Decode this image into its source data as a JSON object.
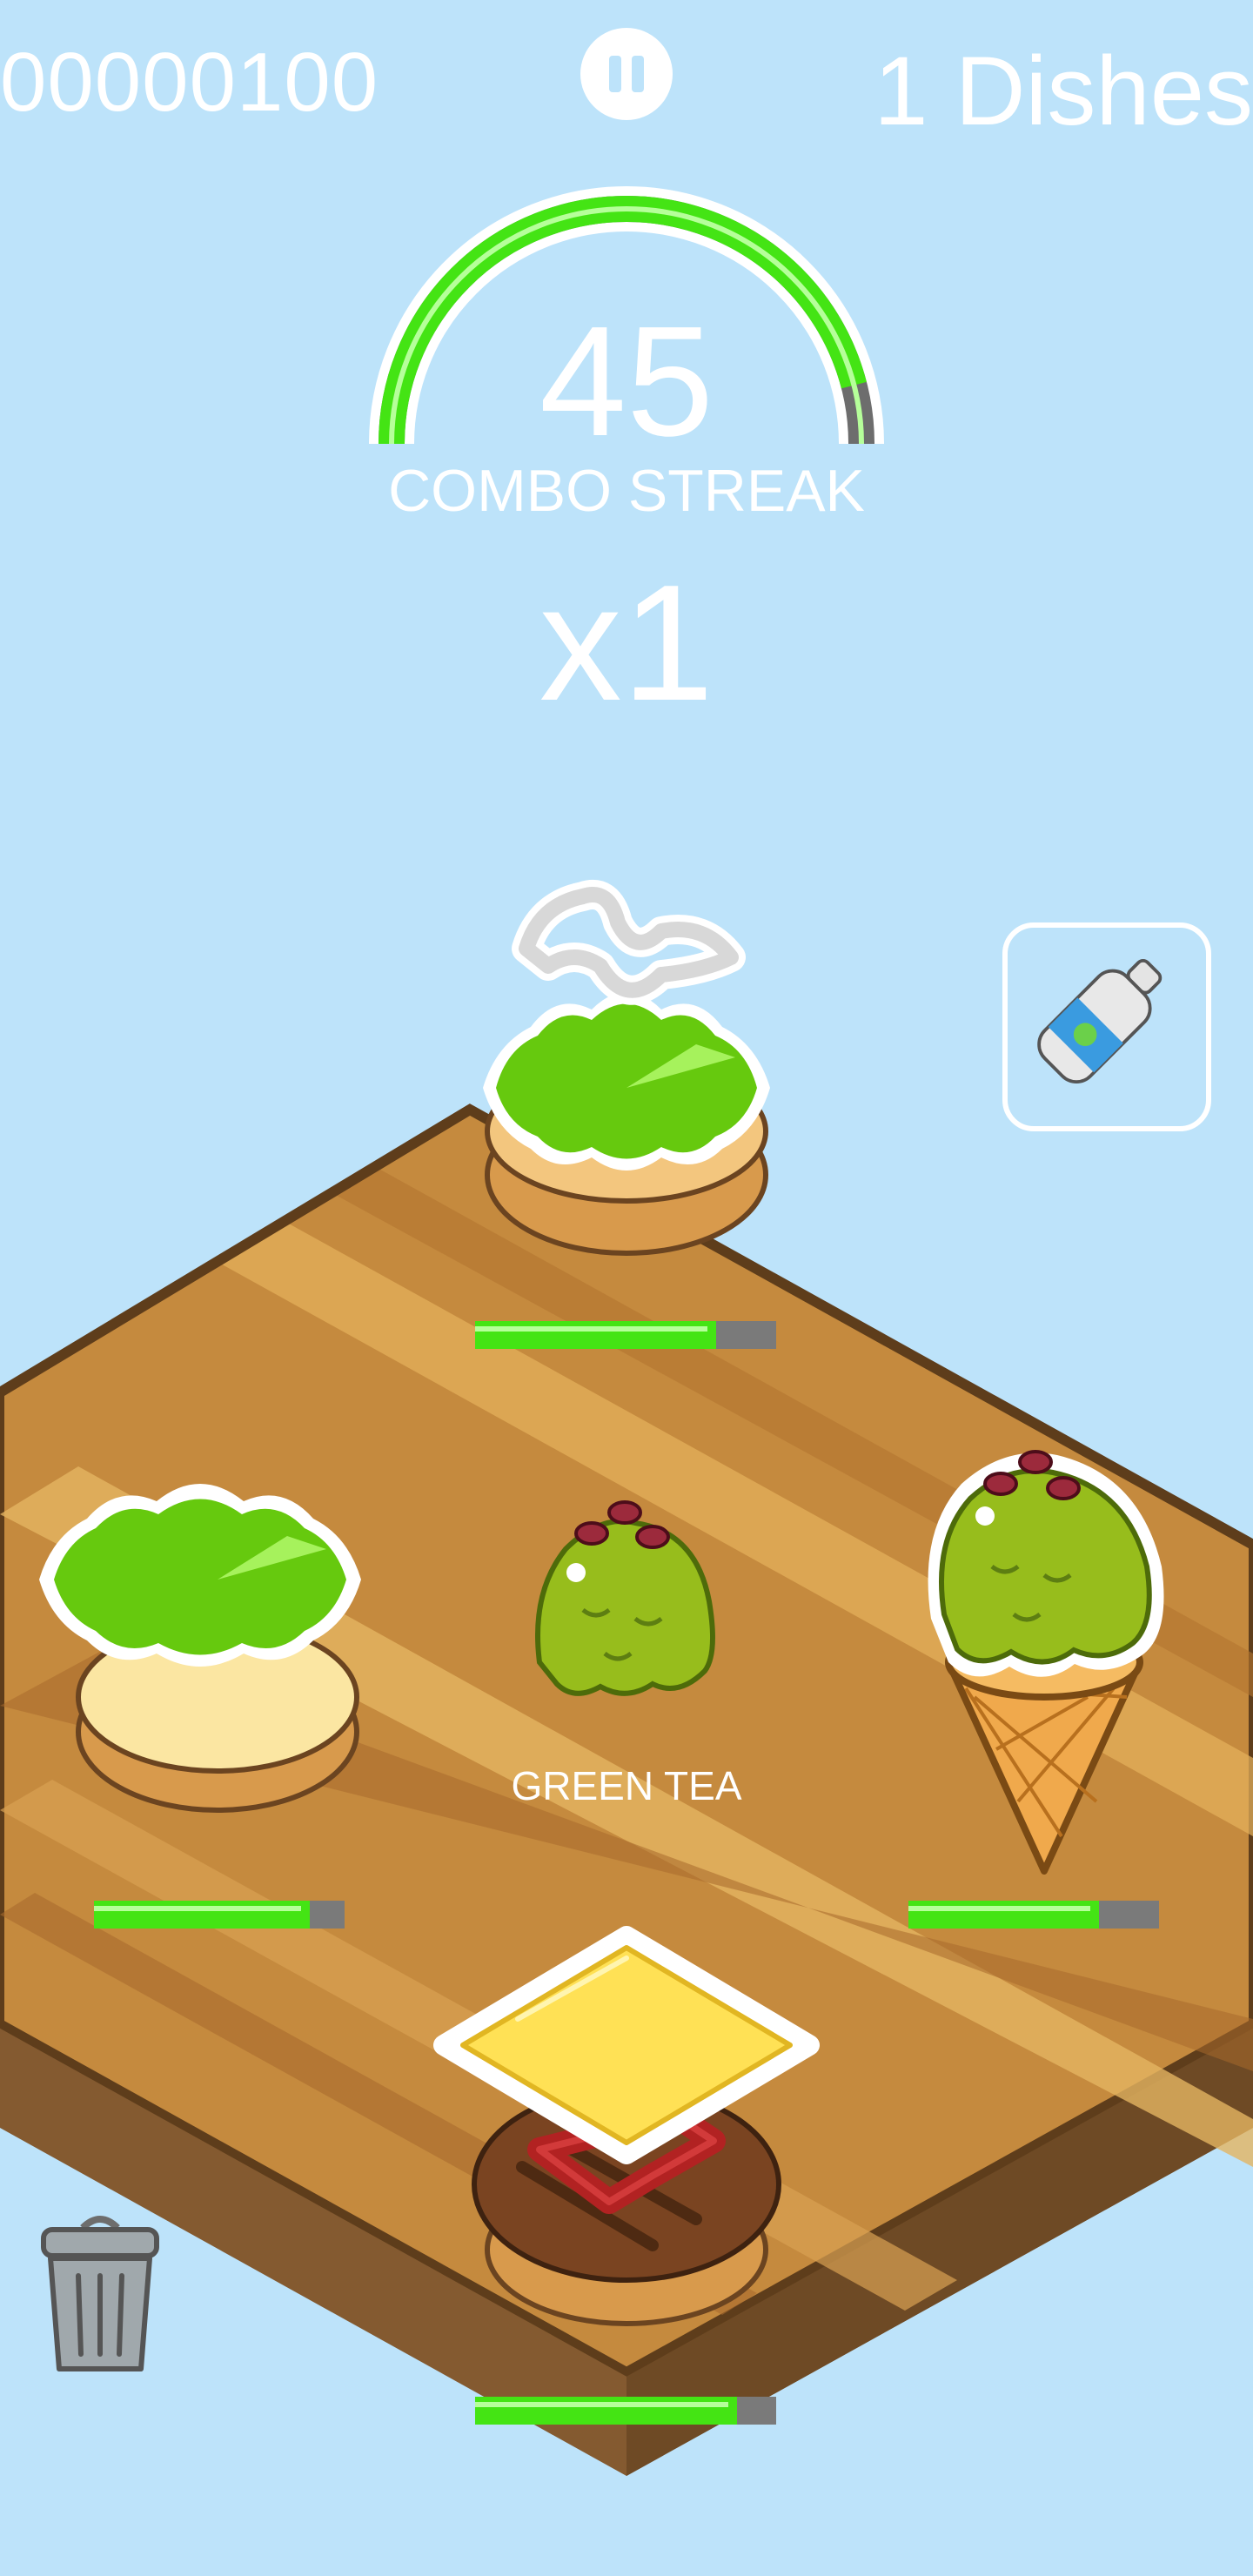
{
  "hud": {
    "score": "00000100",
    "dishes_count": "1",
    "dishes_label": "Dishes",
    "pause_icon": "pause-icon"
  },
  "combo": {
    "timer_fraction": 0.92,
    "streak_value": "45",
    "streak_label": "COMBO STREAK",
    "multiplier": "x1"
  },
  "board": {
    "selected_food_label": "GREEN TEA",
    "stations": [
      {
        "id": "top",
        "contents": [
          "lettuce",
          "mayonnaise",
          "bottom-bun"
        ],
        "timer_fraction": 0.8
      },
      {
        "id": "left",
        "contents": [
          "lettuce",
          "bottom-bun"
        ],
        "timer_fraction": 0.86
      },
      {
        "id": "right",
        "contents": [
          "green-tea-scoop",
          "cone"
        ],
        "timer_fraction": 0.76
      },
      {
        "id": "bottom",
        "contents": [
          "cheese",
          "ketchup",
          "patty",
          "bottom-bun"
        ],
        "timer_fraction": 0.87
      }
    ],
    "center_item": "green-tea-scoop"
  },
  "powerup": {
    "icon": "salt-bottle-icon"
  },
  "trash": {
    "icon": "trash-can-icon"
  },
  "colors": {
    "background": "#bde3fa",
    "timer_fill": "#44e414",
    "timer_empty": "#7a7a7a",
    "lettuce": "#66c90e",
    "board_wood": "#c58a3e"
  }
}
